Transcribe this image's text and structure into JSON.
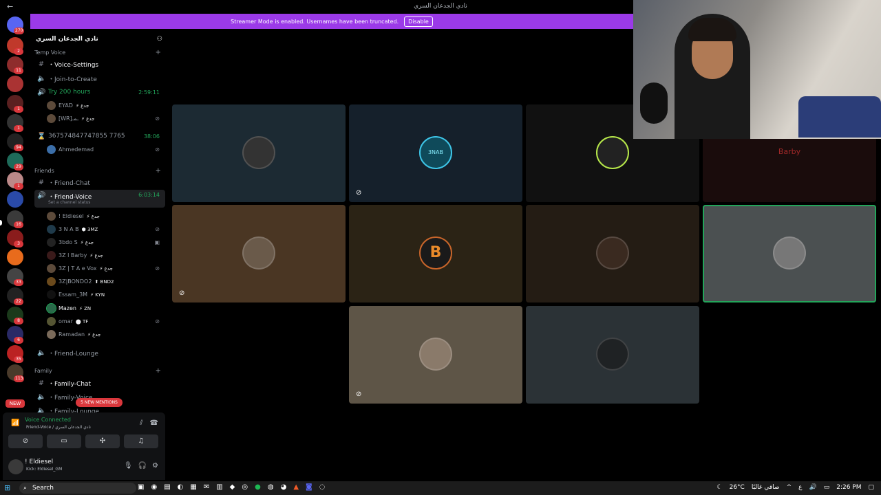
{
  "window": {
    "title": "نادي الجدعان السري"
  },
  "banner": {
    "text": "Streamer Mode is enabled. Usernames have been truncated.",
    "button": "Disable",
    "color": "#9b3ae8"
  },
  "rail": {
    "home_badge": "270",
    "badges": [
      "2",
      "11",
      "1",
      "1",
      "94",
      "29",
      "1",
      "16",
      "3",
      "33",
      "22",
      "8",
      "6",
      "35",
      "113"
    ],
    "new_label": "NEW"
  },
  "server": {
    "name": "نادي الجدعان السري"
  },
  "categories": {
    "temp_voice": "Temp Voice",
    "friends": "Friends",
    "family": "Family"
  },
  "channels": {
    "voice_settings": "・Voice-Settings",
    "join_to_create": "・Join-to-Create",
    "try_200": {
      "name": "Try 200 hours",
      "time": "2:59:11"
    },
    "number_channel": {
      "name": "367574847747855 7765",
      "time": "38:06"
    },
    "friend_chat": "・Friend-Chat",
    "friend_voice": {
      "name": "・Friend-Voice",
      "time": "6:03:14",
      "status": "Set a channel status"
    },
    "friend_lounge": "・Friend-Lounge",
    "family_chat": "・Family-Chat",
    "family_voice": "・Family-Voice",
    "family_lounge": "・Family-Lounge"
  },
  "try_members": [
    {
      "name": "EYAD",
      "tag": "⚡ جدع"
    },
    {
      "name": "[WR]ـمـ",
      "tag": "⚡ جدع"
    }
  ],
  "number_members": [
    {
      "name": "Ahmedemad",
      "tag": ""
    }
  ],
  "friend_members": [
    {
      "name": "! Eldiesel",
      "tag": "⚡ جدع"
    },
    {
      "name": "3 N A B",
      "tag": "⬢ 3MZ"
    },
    {
      "name": "3bdo S",
      "tag": "⚡ جدع"
    },
    {
      "name": "3Z l Barby",
      "tag": "⚡ جدع"
    },
    {
      "name": "3Z | T A e Vox",
      "tag": "⚡ جدع"
    },
    {
      "name": "3Z|BONDO2",
      "tag": "⬆ BND2"
    },
    {
      "name": "Essam_3M",
      "tag": "⚡ KYN"
    },
    {
      "name": "Mazen",
      "tag": "⚡ ZN"
    },
    {
      "name": "omar",
      "tag": "⬤ TF"
    },
    {
      "name": "Ramadan",
      "tag": "⚡ جدع"
    }
  ],
  "mentions": "5 NEW MENTIONS",
  "voice_panel": {
    "status": "Voice Connected",
    "sub": "Friend-Voice / نادي الجدعان السري"
  },
  "user_panel": {
    "name": "! Eldiesel",
    "status": "Kick: Eldiesel_GM"
  },
  "tiles": [
    {
      "id": "t1",
      "avatar_text": "",
      "color": "#1c2a33"
    },
    {
      "id": "t2",
      "avatar_text": "3NAB",
      "color": "#15202b"
    },
    {
      "id": "t3",
      "avatar_text": "",
      "color": "#111"
    },
    {
      "id": "t4",
      "avatar_text": "Barby",
      "color": "#1a0c0c"
    },
    {
      "id": "t5",
      "avatar_text": "",
      "color": "#4a3623"
    },
    {
      "id": "t6",
      "avatar_text": "B",
      "color": "#2b2315"
    },
    {
      "id": "t7",
      "avatar_text": "",
      "color": "#241c14"
    },
    {
      "id": "t8",
      "avatar_text": "",
      "color": "#4b5051"
    },
    {
      "id": "t9",
      "avatar_text": "",
      "color": "#5e5547"
    },
    {
      "id": "t10",
      "avatar_text": "",
      "color": "#2b3236"
    }
  ],
  "taskbar": {
    "search": "Search",
    "weather": "26°C",
    "weather_text": "صافي غالبًا",
    "lang": "ع",
    "time": "2:26 PM"
  }
}
